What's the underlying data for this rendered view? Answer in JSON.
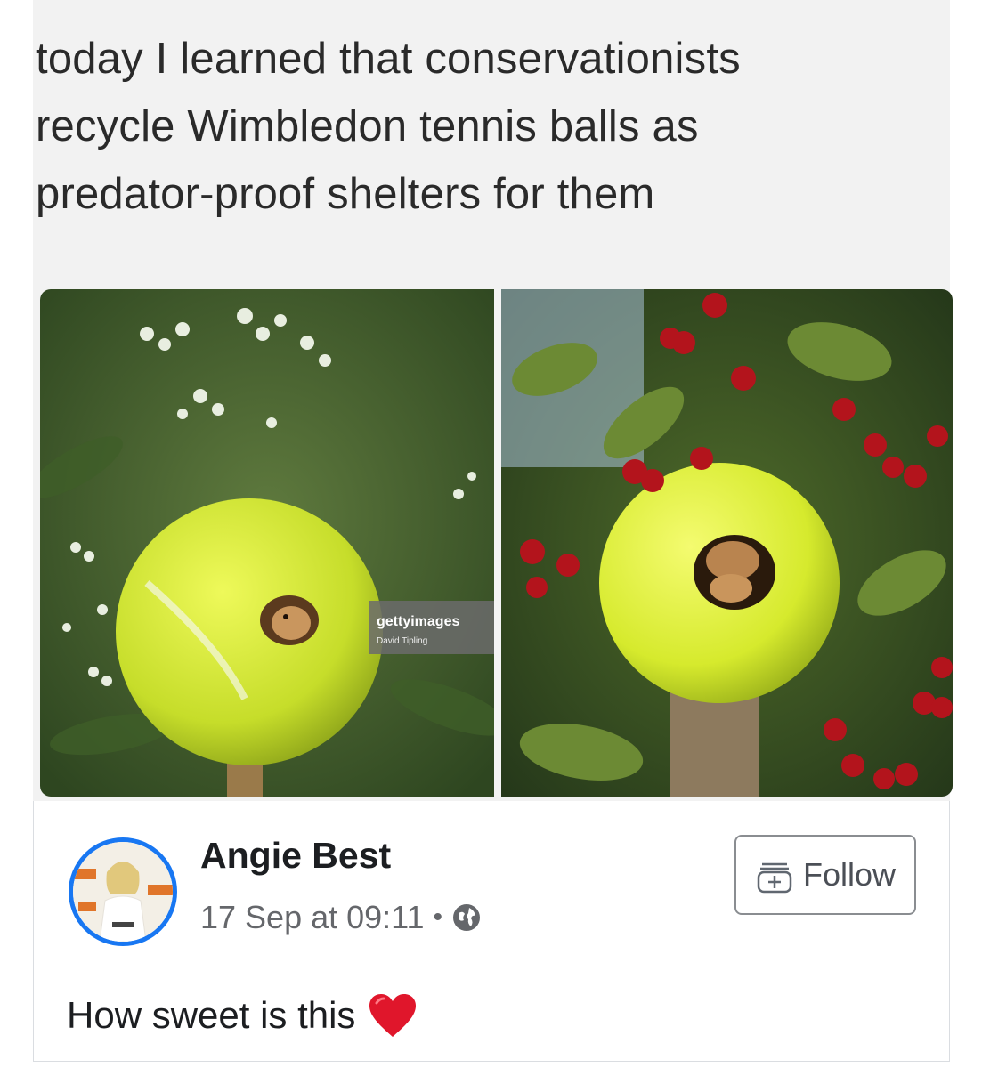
{
  "meme": {
    "caption_lines": [
      "today I learned that conservationists",
      "recycle Wimbledon tennis balls as",
      "predator-proof shelters for them"
    ],
    "watermark_brand": "gettyimages",
    "watermark_credit": "David Tipling"
  },
  "post": {
    "author": "Angie Best",
    "timestamp": "17 Sep at 09:11",
    "separator": "•",
    "privacy_icon": "globe-icon",
    "follow_label": "Follow",
    "follow_icon": "add-friend-icon",
    "text": "How sweet is this",
    "emoji": "heart-icon",
    "emoji_color": "#e0162b"
  },
  "colors": {
    "tennis_ball": "#d9ee3a",
    "avatar_ring": "#1877f2",
    "berry": "#b3141c"
  }
}
